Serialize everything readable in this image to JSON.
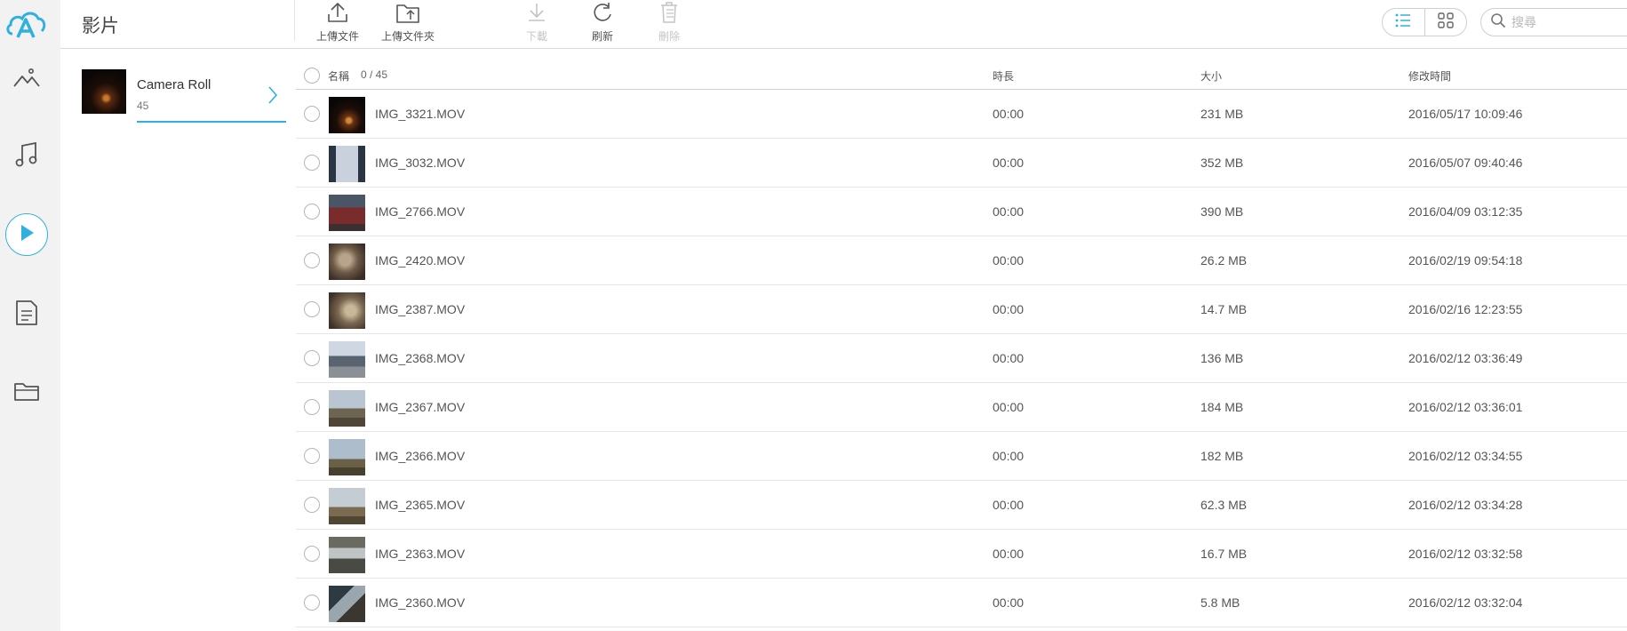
{
  "header": {
    "title": "影片",
    "toolbar": {
      "upload_file": "上傳文件",
      "upload_folder": "上傳文件夾",
      "download": "下載",
      "refresh": "刷新",
      "delete": "刪除"
    },
    "search_placeholder": "搜尋"
  },
  "accent_color": "#31b0e0",
  "sidebar": {
    "items": [
      {
        "icon": "photos-icon"
      },
      {
        "icon": "music-icon"
      },
      {
        "icon": "video-icon",
        "active": true
      },
      {
        "icon": "document-icon"
      },
      {
        "icon": "folder-icon"
      }
    ]
  },
  "album": {
    "name": "Camera Roll",
    "count": "45"
  },
  "table": {
    "headers": {
      "name": "名稱",
      "selection": "0 / 45",
      "duration": "時長",
      "size": "大小",
      "modified": "修改時間"
    },
    "rows": [
      {
        "name": "IMG_3321.MOV",
        "duration": "00:00",
        "size": "231 MB",
        "modified": "2016/05/17 10:09:46"
      },
      {
        "name": "IMG_3032.MOV",
        "duration": "00:00",
        "size": "352 MB",
        "modified": "2016/05/07 09:40:46"
      },
      {
        "name": "IMG_2766.MOV",
        "duration": "00:00",
        "size": "390 MB",
        "modified": "2016/04/09 03:12:35"
      },
      {
        "name": "IMG_2420.MOV",
        "duration": "00:00",
        "size": "26.2 MB",
        "modified": "2016/02/19 09:54:18"
      },
      {
        "name": "IMG_2387.MOV",
        "duration": "00:00",
        "size": "14.7 MB",
        "modified": "2016/02/16 12:23:55"
      },
      {
        "name": "IMG_2368.MOV",
        "duration": "00:00",
        "size": "136 MB",
        "modified": "2016/02/12 03:36:49"
      },
      {
        "name": "IMG_2367.MOV",
        "duration": "00:00",
        "size": "184 MB",
        "modified": "2016/02/12 03:36:01"
      },
      {
        "name": "IMG_2366.MOV",
        "duration": "00:00",
        "size": "182 MB",
        "modified": "2016/02/12 03:34:55"
      },
      {
        "name": "IMG_2365.MOV",
        "duration": "00:00",
        "size": "62.3 MB",
        "modified": "2016/02/12 03:34:28"
      },
      {
        "name": "IMG_2363.MOV",
        "duration": "00:00",
        "size": "16.7 MB",
        "modified": "2016/02/12 03:32:58"
      },
      {
        "name": "IMG_2360.MOV",
        "duration": "00:00",
        "size": "5.8 MB",
        "modified": "2016/02/12 03:32:04"
      }
    ]
  }
}
